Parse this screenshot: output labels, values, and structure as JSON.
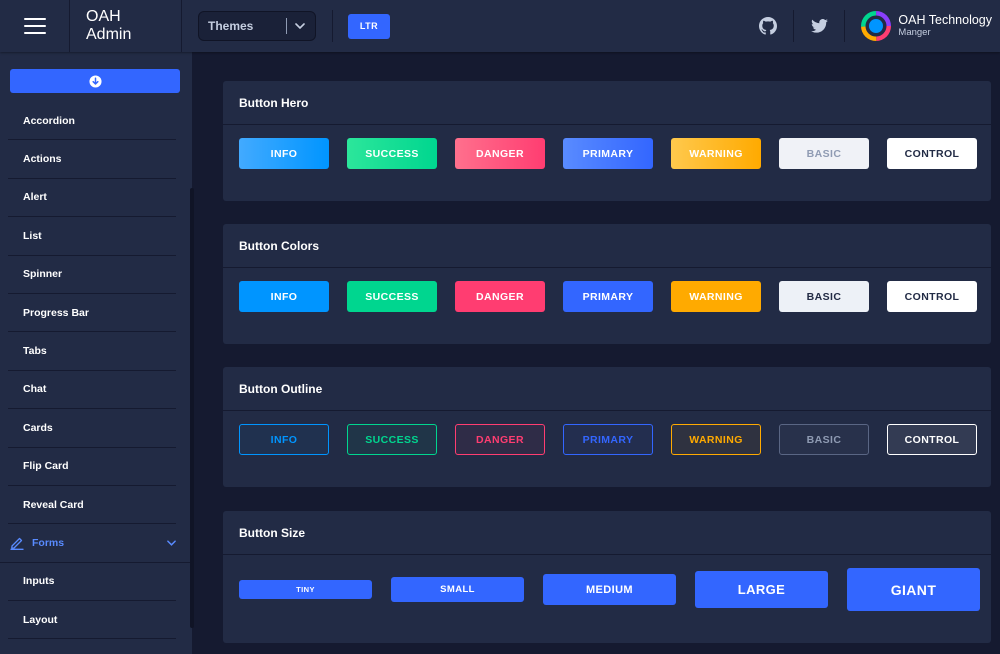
{
  "header": {
    "brand": "OAH Admin",
    "theme_select": {
      "value": "Themes"
    },
    "direction_button": "LTR",
    "user": {
      "name": "OAH Technology",
      "role": "Manger"
    }
  },
  "sidebar": {
    "items": [
      {
        "label": "Accordion"
      },
      {
        "label": "Actions"
      },
      {
        "label": "Alert"
      },
      {
        "label": "List"
      },
      {
        "label": "Spinner"
      },
      {
        "label": "Progress Bar"
      },
      {
        "label": "Tabs"
      },
      {
        "label": "Chat"
      },
      {
        "label": "Cards"
      },
      {
        "label": "Flip Card"
      },
      {
        "label": "Reveal Card"
      }
    ],
    "group": {
      "label": "Forms"
    },
    "subitems": [
      {
        "label": "Inputs"
      },
      {
        "label": "Layout"
      }
    ]
  },
  "cards": {
    "hero": {
      "title": "Button Hero",
      "buttons": [
        "INFO",
        "SUCCESS",
        "DANGER",
        "PRIMARY",
        "WARNING",
        "BASIC",
        "CONTROL"
      ]
    },
    "colors": {
      "title": "Button Colors",
      "buttons": [
        "INFO",
        "SUCCESS",
        "DANGER",
        "PRIMARY",
        "WARNING",
        "BASIC",
        "CONTROL"
      ]
    },
    "outline": {
      "title": "Button Outline",
      "buttons": [
        "INFO",
        "SUCCESS",
        "DANGER",
        "PRIMARY",
        "WARNING",
        "BASIC",
        "CONTROL"
      ]
    },
    "size": {
      "title": "Button Size",
      "buttons": [
        "TINY",
        "SMALL",
        "MEDIUM",
        "LARGE",
        "GIANT"
      ]
    }
  },
  "colors": {
    "primary": "#3366ff",
    "info": "#0095ff",
    "success": "#00d68f",
    "danger": "#ff3d71",
    "warning": "#ffaa00",
    "background": "#151a30",
    "surface": "#222b45"
  },
  "icons": {
    "menu": "hamburger-menu-icon",
    "github": "github-icon",
    "twitter": "twitter-icon",
    "collapse": "arrow-circle-down-icon",
    "forms": "edit-pencil-icon",
    "chevron": "chevron-down-icon"
  }
}
